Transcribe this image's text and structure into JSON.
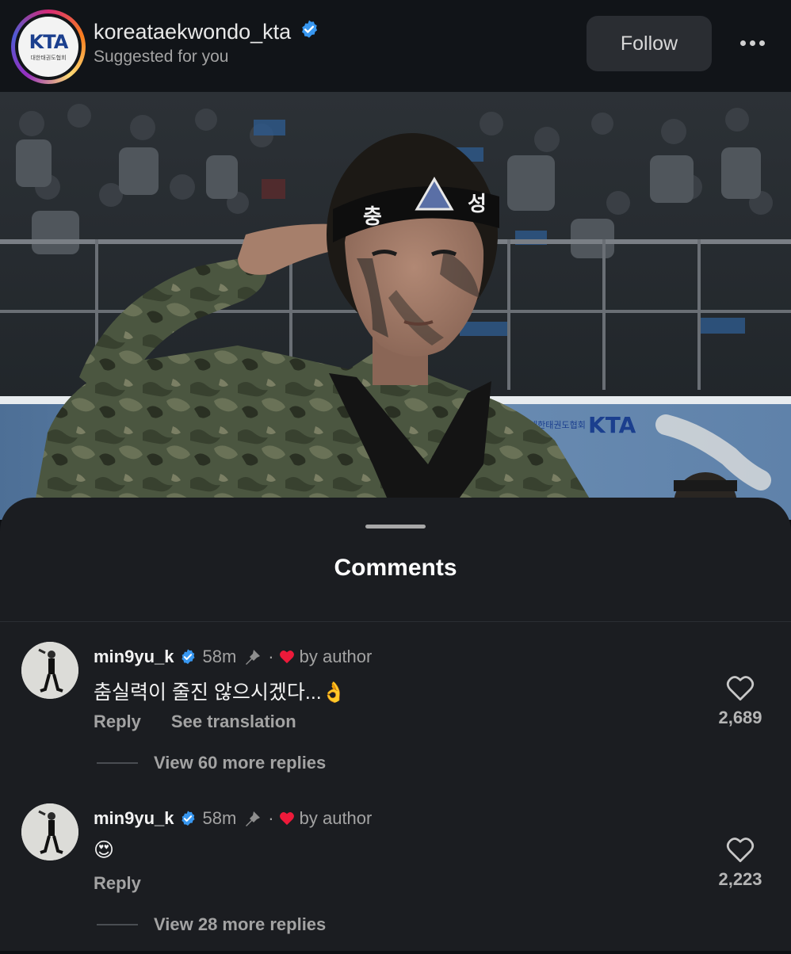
{
  "header": {
    "account_name": "koreataekwondo_kta",
    "subtitle": "Suggested for you",
    "follow_label": "Follow",
    "logo_text": "KTA",
    "logo_subtext": "대한태권도협회"
  },
  "photo": {
    "headband_text": "충성",
    "banner_logo_text": "KTA",
    "banner_org_text": "대한태권도협회"
  },
  "comments_sheet": {
    "title": "Comments",
    "comments": [
      {
        "username": "min9yu_k",
        "time": "58m",
        "separator": "·",
        "liked_by": "by author",
        "text": "춤실력이 줄진 않으시겠다...👌",
        "reply_label": "Reply",
        "translate_label": "See translation",
        "like_count": "2,689",
        "view_replies": "View 60 more replies"
      },
      {
        "username": "min9yu_k",
        "time": "58m",
        "separator": "·",
        "liked_by": "by author",
        "text": "😍",
        "reply_label": "Reply",
        "like_count": "2,223",
        "view_replies": "View 28 more replies"
      }
    ]
  },
  "colors": {
    "background": "#0d0f13",
    "sheet": "#1b1d21",
    "verified": "#3897f0",
    "heart_red": "#ed1a3a",
    "muted_text": "#a3a3a3"
  },
  "icons": [
    "verified-badge-icon",
    "more-options-icon",
    "pin-icon",
    "heart-filled-icon",
    "heart-outline-icon"
  ]
}
